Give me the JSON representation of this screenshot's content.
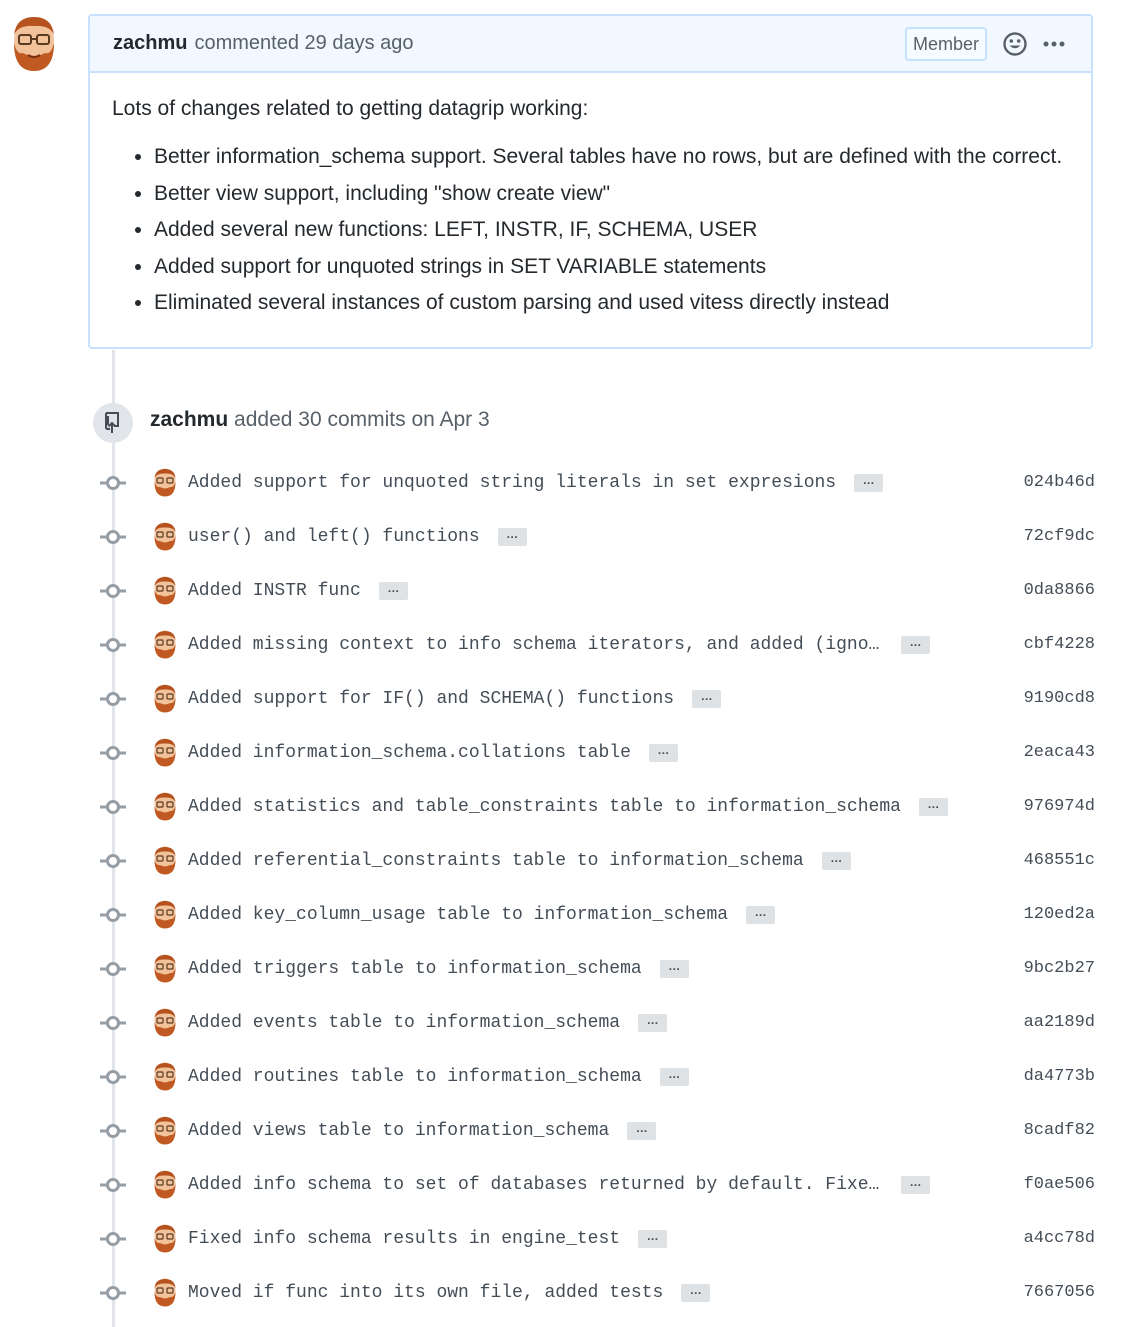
{
  "comment": {
    "author": "zachmu",
    "meta": "commented 29 days ago",
    "badge": "Member",
    "intro": "Lots of changes related to getting datagrip working:",
    "bullets": [
      "Better information_schema support. Several tables have no rows, but are defined with the correct.",
      "Better view support, including \"show create view\"",
      "Added several new functions: LEFT, INSTR, IF, SCHEMA, USER",
      "Added support for unquoted strings in SET VARIABLE statements",
      "Eliminated several instances of custom parsing and used vitess directly instead"
    ]
  },
  "push_event": {
    "actor": "zachmu",
    "summary": "added 30 commits on Apr 3"
  },
  "commits": [
    {
      "message": "Added support for unquoted string literals in set expresions",
      "sha": "024b46d"
    },
    {
      "message": "user() and left() functions",
      "sha": "72cf9dc"
    },
    {
      "message": "Added INSTR func",
      "sha": "0da8866"
    },
    {
      "message": "Added missing context to info schema iterators, and added (ignored) c…",
      "sha": "cbf4228"
    },
    {
      "message": "Added support for IF() and SCHEMA() functions",
      "sha": "9190cd8"
    },
    {
      "message": "Added information_schema.collations table",
      "sha": "2eaca43"
    },
    {
      "message": "Added statistics and table_constraints table to information_schema",
      "sha": "976974d"
    },
    {
      "message": "Added referential_constraints table to information_schema",
      "sha": "468551c"
    },
    {
      "message": "Added key_column_usage table to information_schema",
      "sha": "120ed2a"
    },
    {
      "message": "Added triggers table to information_schema",
      "sha": "9bc2b27"
    },
    {
      "message": "Added events table to information_schema",
      "sha": "aa2189d"
    },
    {
      "message": "Added routines table to information_schema",
      "sha": "da4773b"
    },
    {
      "message": "Added views table to information_schema",
      "sha": "8cadf82"
    },
    {
      "message": "Added info schema to set of databases returned by default. Fixed nil …",
      "sha": "f0ae506"
    },
    {
      "message": "Fixed info schema results in engine_test",
      "sha": "a4cc78d"
    },
    {
      "message": "Moved if func into its own file, added tests",
      "sha": "7667056"
    }
  ],
  "expander_label": "…"
}
